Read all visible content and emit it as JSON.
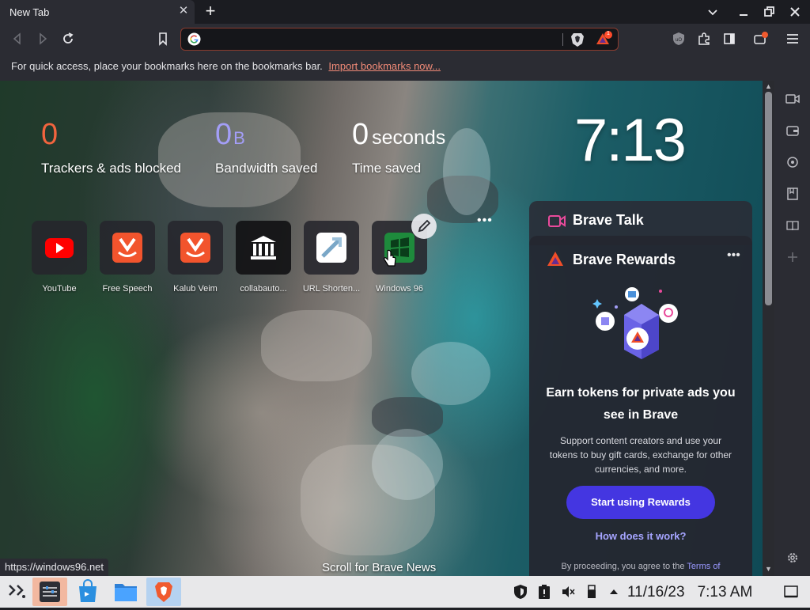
{
  "browser": {
    "tab_title": "New Tab",
    "tab_close": "✕",
    "new_tab": "+",
    "bookmarks_message": "For quick access, place your bookmarks here on the bookmarks bar.",
    "import_link": "Import bookmarks now...",
    "shields_badge": "1",
    "status_url": "https://windows96.net"
  },
  "stats": {
    "trackers_value": "0",
    "trackers_label": "Trackers & ads blocked",
    "bandwidth_value": "0",
    "bandwidth_unit": "B",
    "bandwidth_label": "Bandwidth saved",
    "time_value": "0",
    "time_unit": "seconds",
    "time_label": "Time saved"
  },
  "clock": "7:13",
  "top_sites": [
    {
      "label": "YouTube"
    },
    {
      "label": "Free Speech"
    },
    {
      "label": "Kalub Veim"
    },
    {
      "label": "collabauto..."
    },
    {
      "label": "URL Shorten..."
    },
    {
      "label": "Windows 96"
    }
  ],
  "sites_more": "•••",
  "brave_talk": {
    "title": "Brave Talk"
  },
  "rewards": {
    "title": "Brave Rewards",
    "more": "•••",
    "headline": "Earn tokens for private ads you see in Brave",
    "body": "Support content creators and use your tokens to buy gift cards, exchange for other currencies, and more.",
    "cta": "Start using Rewards",
    "how": "How does it work?",
    "legal_prefix": "By proceeding, you agree to the",
    "legal_link": "Terms of"
  },
  "scroll_news": "Scroll for Brave News",
  "taskbar": {
    "date": "11/16/23",
    "time": "7:13 AM"
  },
  "colors": {
    "trackers": "#f2643e",
    "bandwidth": "#a39ef7",
    "accent": "#4436e1",
    "omnibox_border": "#8b3c2f"
  }
}
